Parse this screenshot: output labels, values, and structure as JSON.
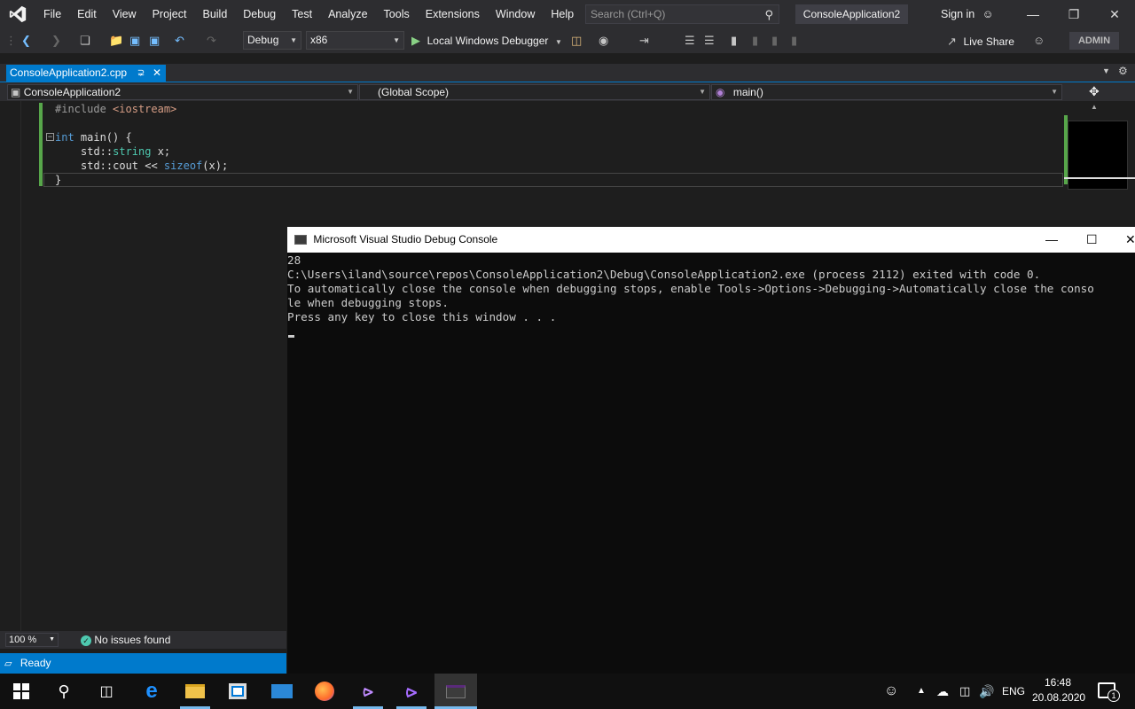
{
  "menu": {
    "items": [
      "File",
      "Edit",
      "View",
      "Project",
      "Build",
      "Debug",
      "Test",
      "Analyze",
      "Tools",
      "Extensions",
      "Window",
      "Help"
    ]
  },
  "search": {
    "placeholder": "Search (Ctrl+Q)"
  },
  "solution_name": "ConsoleApplication2",
  "sign_in": "Sign in",
  "toolbar": {
    "config": "Debug",
    "platform": "x86",
    "debugger": "Local Windows Debugger",
    "live_share": "Live Share",
    "admin": "ADMIN"
  },
  "tab": {
    "label": "ConsoleApplication2.cpp"
  },
  "nav": {
    "project": "ConsoleApplication2",
    "scope": "(Global Scope)",
    "member": "main()"
  },
  "code": {
    "line1_pp": "#include ",
    "line1_hdr": "<iostream>",
    "line3_kw": "int",
    "line3_rest": " main() {",
    "line4_ns": "std::",
    "line4_ty": "string",
    "line4_rest": " x;",
    "line5_a": "std::cout << ",
    "line5_fn": "sizeof",
    "line5_b": "(x);",
    "line6": "}"
  },
  "editor_status": {
    "zoom": "100 %",
    "issues": "No issues found"
  },
  "status": {
    "text": "Ready"
  },
  "console": {
    "title": "Microsoft Visual Studio Debug Console",
    "lines": [
      "28",
      "C:\\Users\\iland\\source\\repos\\ConsoleApplication2\\Debug\\ConsoleApplication2.exe (process 2112) exited with code 0.",
      "To automatically close the console when debugging stops, enable Tools->Options->Debugging->Automatically close the conso",
      "le when debugging stops.",
      "Press any key to close this window . . ."
    ]
  },
  "taskbar": {
    "lang": "ENG",
    "time": "16:48",
    "date": "20.08.2020",
    "notif_count": "1"
  },
  "colors": {
    "accent": "#007acc",
    "bg": "#1e1e1e",
    "chrome": "#2d2d30"
  }
}
